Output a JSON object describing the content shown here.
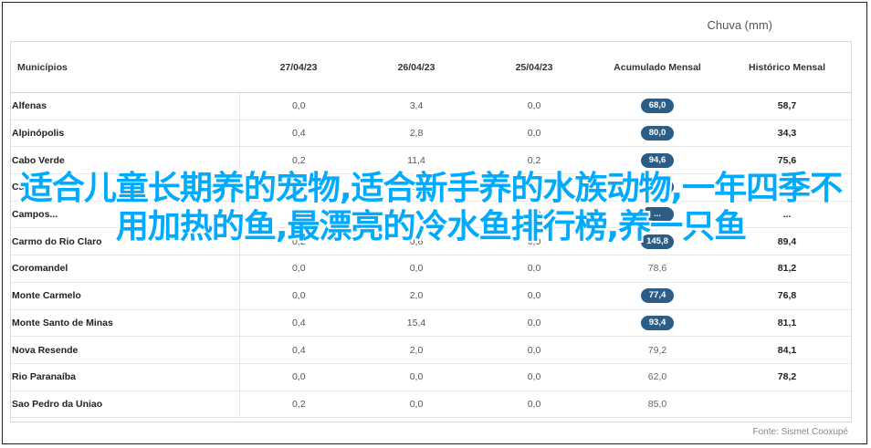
{
  "header": {
    "chuva": "Chuva (mm)"
  },
  "columns": [
    "Municípios",
    "27/04/23",
    "26/04/23",
    "25/04/23",
    "Acumulado Mensal",
    "Histórico Mensal"
  ],
  "rows": [
    [
      "Alfenas",
      "0,0",
      "3,4",
      "0,0",
      "68,0",
      "58,7",
      true
    ],
    [
      "Alpinópolis",
      "0,4",
      "2,8",
      "0,0",
      "80,0",
      "34,3",
      true
    ],
    [
      "Cabo Verde",
      "0,2",
      "11,4",
      "0,2",
      "94,6",
      "75,6",
      true
    ],
    [
      "Cabo...",
      "0,1",
      "...",
      "0,0",
      "...",
      "...",
      true
    ],
    [
      "Campos...",
      "0,2",
      "...",
      "0,0",
      "...",
      "...",
      true
    ],
    [
      "Carmo do Rio Claro",
      "0,2",
      "0,6",
      "0,0",
      "145,8",
      "89,4",
      true
    ],
    [
      "Coromandel",
      "0,0",
      "0,0",
      "0,0",
      "78,6",
      "81,2",
      false
    ],
    [
      "Monte Carmelo",
      "0,0",
      "2,0",
      "0,0",
      "77,4",
      "76,8",
      true
    ],
    [
      "Monte Santo de Minas",
      "0,4",
      "15,4",
      "0,0",
      "93,4",
      "81,1",
      true
    ],
    [
      "Nova Resende",
      "0,4",
      "2,0",
      "0,0",
      "79,2",
      "84,1",
      false
    ],
    [
      "Rio Paranaíba",
      "0,0",
      "0,0",
      "0,0",
      "62,0",
      "78,2",
      false
    ],
    [
      "Sao Pedro da Uniao",
      "0,2",
      "0,0",
      "0,0",
      "85,0",
      "",
      false
    ]
  ],
  "overlay_text": "适合儿童长期养的宠物,适合新手养的水族动物,一年四季不用加热的鱼,最漂亮的冷水鱼排行榜,养一只鱼",
  "footer": {
    "source": "Fonte: Sismet Cooxupé"
  },
  "colors": {
    "pill": "#2c5d87",
    "overlay": "#00aaff"
  }
}
